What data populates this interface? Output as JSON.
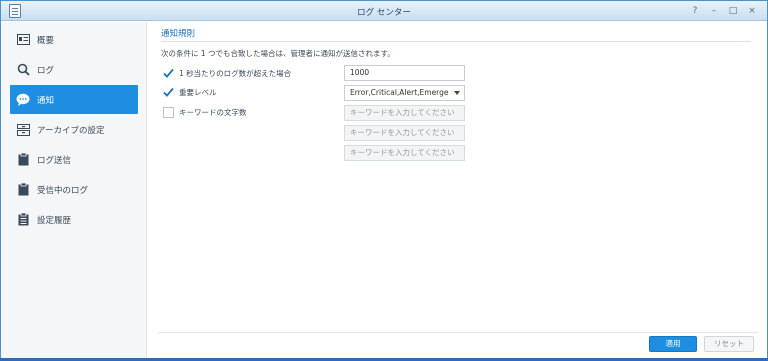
{
  "window": {
    "title": "ログ センター",
    "controls": [
      "?",
      "–",
      "□",
      "×"
    ]
  },
  "sidebar": {
    "items": [
      {
        "label": "概要",
        "icon": "overview-card-icon"
      },
      {
        "label": "ログ",
        "icon": "search-icon"
      },
      {
        "label": "通知",
        "icon": "chat-bubble-icon",
        "active": true
      },
      {
        "label": "アーカイブの設定",
        "icon": "archive-icon"
      },
      {
        "label": "ログ送信",
        "icon": "clipboard-icon"
      },
      {
        "label": "受信中のログ",
        "icon": "clipboard-icon"
      },
      {
        "label": "設定履歴",
        "icon": "clipboard-list-icon"
      }
    ]
  },
  "main": {
    "section_title": "通知規則",
    "description": "次の条件に 1 つでも合致した場合は、管理者に通知が送信されます。",
    "rules": [
      {
        "label": "1 秒当たりのログ数が超えた場合",
        "checked": true,
        "value": "1000"
      },
      {
        "label": "重要レベル",
        "checked": true,
        "value": "Error,Critical,Alert,Emerge"
      },
      {
        "label": "キーワードの文字数",
        "checked": false
      }
    ],
    "keyword_placeholder": "キーワードを入力してください",
    "buttons": {
      "apply": "適用",
      "reset": "リセット"
    }
  },
  "colors": {
    "accent": "#1e8ee0",
    "section_title": "#1e6fb6"
  }
}
